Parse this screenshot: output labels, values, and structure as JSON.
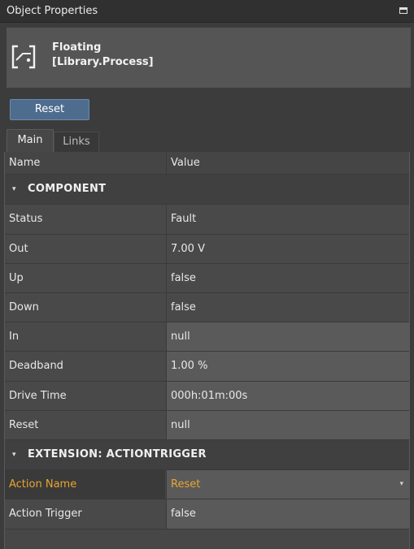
{
  "panel": {
    "title": "Object Properties"
  },
  "object": {
    "name": "Floating",
    "type": "[Library.Process]"
  },
  "reset_button": "Reset",
  "tabs": [
    {
      "label": "Main"
    },
    {
      "label": "Links"
    }
  ],
  "grid": {
    "columns": {
      "name": "Name",
      "value": "Value"
    },
    "sections": [
      {
        "label": "COMPONENT",
        "rows": [
          {
            "name": "Status",
            "value": "Fault"
          },
          {
            "name": "Out",
            "value": "7.00 V"
          },
          {
            "name": "Up",
            "value": "false"
          },
          {
            "name": "Down",
            "value": "false"
          },
          {
            "name": "In",
            "value": "null"
          },
          {
            "name": "Deadband",
            "value": "1.00 %"
          },
          {
            "name": "Drive Time",
            "value": "000h:01m:00s"
          },
          {
            "name": "Reset",
            "value": "null"
          }
        ]
      },
      {
        "label": "EXTENSION: ACTIONTRIGGER",
        "rows": [
          {
            "name": "Action Name",
            "value": "Reset"
          },
          {
            "name": "Action Trigger",
            "value": "false"
          }
        ]
      }
    ]
  },
  "colors": {
    "accent": "#e8a530",
    "button": "#4e6c8e",
    "panel_bg": "#3c3c3c"
  },
  "icons": {
    "object": "floating-process-icon",
    "collapse": "chevron-down-icon",
    "maximize": "maximize-icon",
    "dropdown": "dropdown-arrow-icon"
  }
}
